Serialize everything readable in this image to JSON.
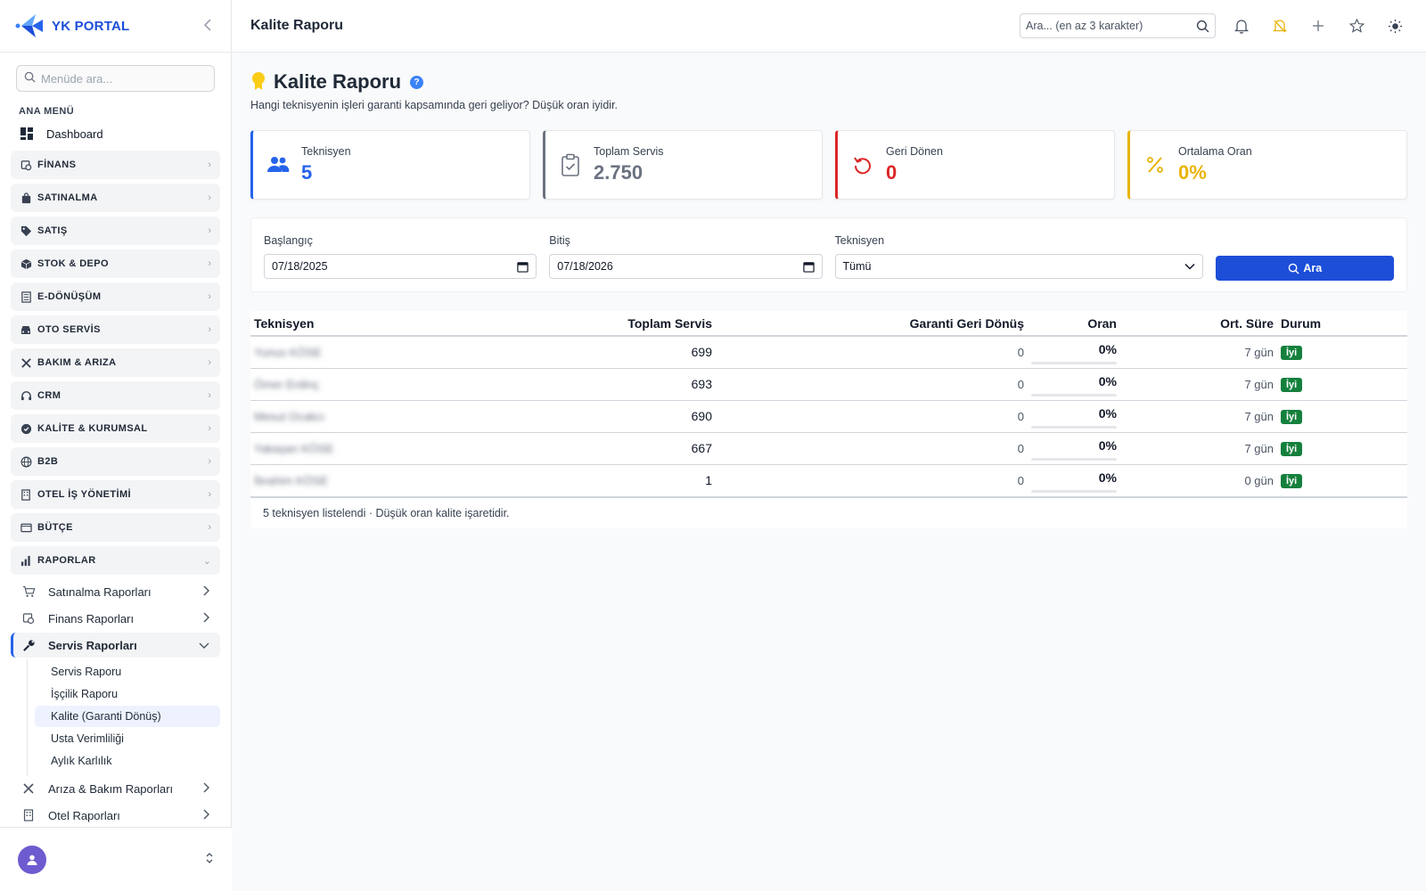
{
  "brand": {
    "name": "YK PORTAL"
  },
  "sidebar": {
    "search_placeholder": "Menüde ara...",
    "heading": "ANA MENÜ",
    "dashboard": "Dashboard",
    "groups": [
      {
        "label": "FİNANS",
        "icon": "finance-icon"
      },
      {
        "label": "SATINALMA",
        "icon": "bag-icon"
      },
      {
        "label": "SATIŞ",
        "icon": "tag-icon"
      },
      {
        "label": "STOK & DEPO",
        "icon": "box-icon"
      },
      {
        "label": "E-DÖNÜŞÜM",
        "icon": "document-icon"
      },
      {
        "label": "OTO SERVİS",
        "icon": "car-icon"
      },
      {
        "label": "BAKIM & ARIZA",
        "icon": "tools-icon"
      },
      {
        "label": "CRM",
        "icon": "headset-icon"
      },
      {
        "label": "KALİTE & KURUMSAL",
        "icon": "shield-check-icon"
      },
      {
        "label": "B2B",
        "icon": "globe-icon"
      },
      {
        "label": "OTEL İŞ YÖNETİMİ",
        "icon": "building-icon"
      },
      {
        "label": "BÜTÇE",
        "icon": "wallet-icon"
      },
      {
        "label": "RAPORLAR",
        "icon": "bar-chart-icon"
      }
    ],
    "report_items": [
      {
        "label": "Satınalma Raporları",
        "icon": "cart-icon"
      },
      {
        "label": "Finans Raporları",
        "icon": "finance-icon"
      },
      {
        "label": "Servis Raporları",
        "icon": "wrench-icon"
      }
    ],
    "service_leaves": [
      "Servis Raporu",
      "İşçilik Raporu",
      "Kalite (Garanti Dönüş)",
      "Usta Verimliliği",
      "Aylık Karlılık"
    ],
    "more_items": [
      {
        "label": "Arıza & Bakım Raporları",
        "icon": "tools-icon"
      },
      {
        "label": "Otel Raporları",
        "icon": "building-icon"
      }
    ]
  },
  "topbar": {
    "title": "Kalite Raporu",
    "search_placeholder": "Ara... (en az 3 karakter)"
  },
  "page": {
    "title": "Kalite Raporu",
    "help": "?",
    "subtitle": "Hangi teknisyenin işleri garanti kapsamında geri geliyor? Düşük oran iyidir."
  },
  "cards": [
    {
      "label": "Teknisyen",
      "value": "5",
      "color": "#2563eb",
      "icon": "users-icon"
    },
    {
      "label": "Toplam Servis",
      "value": "2.750",
      "color": "#6b7280",
      "icon": "clipboard-check-icon"
    },
    {
      "label": "Geri Dönen",
      "value": "0",
      "color": "#dc2626",
      "icon": "undo-icon"
    },
    {
      "label": "Ortalama Oran",
      "value": "0%",
      "color": "#eab308",
      "icon": "percent-icon"
    }
  ],
  "filters": {
    "start_label": "Başlangıç",
    "start_value": "07/18/2025",
    "end_label": "Bitiş",
    "end_value": "07/18/2026",
    "tech_label": "Teknisyen",
    "tech_value": "Tümü",
    "search_button": "Ara"
  },
  "table": {
    "headers": [
      "Teknisyen",
      "Toplam Servis",
      "Garanti Geri Dönüş",
      "Oran",
      "Ort. Süre",
      "Durum"
    ],
    "rows": [
      {
        "name": "Yunus KÖSE",
        "total": "699",
        "returns": "0",
        "rate": "0%",
        "rate_value": 0,
        "avg": "7 gün",
        "status": "İyi"
      },
      {
        "name": "Ömer Erdinç",
        "total": "693",
        "returns": "0",
        "rate": "0%",
        "rate_value": 0,
        "avg": "7 gün",
        "status": "İyi"
      },
      {
        "name": "Mesut Ocakcı",
        "total": "690",
        "returns": "0",
        "rate": "0%",
        "rate_value": 0,
        "avg": "7 gün",
        "status": "İyi"
      },
      {
        "name": "Yakaşan KÖSE",
        "total": "667",
        "returns": "0",
        "rate": "0%",
        "rate_value": 0,
        "avg": "7 gün",
        "status": "İyi"
      },
      {
        "name": "İbrahim KÖSE",
        "total": "1",
        "returns": "0",
        "rate": "0%",
        "rate_value": 0,
        "avg": "0 gün",
        "status": "İyi"
      }
    ],
    "footer": "5 teknisyen listelendi · Düşük oran kalite işaretidir."
  },
  "colors": {
    "accent": "#1d4ed8",
    "status_good": "#15803d"
  }
}
